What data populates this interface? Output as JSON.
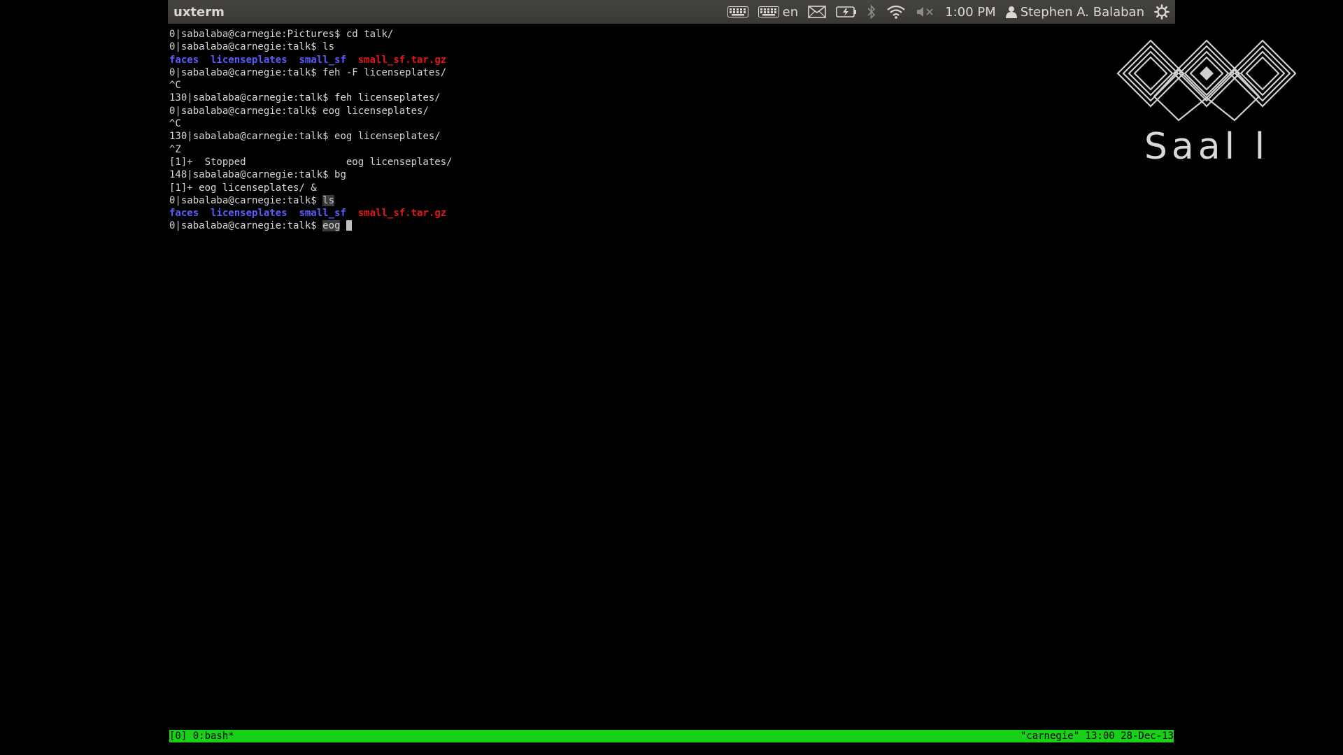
{
  "panel": {
    "window_title": "uxterm",
    "keyboard_layout": "en",
    "clock": "1:00 PM",
    "user_name": "Stephen A. Balaban",
    "icons": [
      "keyboard-icon",
      "keyboard-layout-icon",
      "mail-icon",
      "battery-icon",
      "bluetooth-icon",
      "wifi-icon",
      "volume-muted-icon",
      "user-icon",
      "gear-icon"
    ]
  },
  "terminal": {
    "lines": [
      {
        "prompt": "0|sabalaba@carnegie:Pictures$ ",
        "cmd": "cd talk/"
      },
      {
        "prompt": "0|sabalaba@carnegie:talk$ ",
        "cmd": "ls"
      },
      {
        "listing": [
          "faces",
          "licenseplates",
          "small_sf",
          "small_sf.tar.gz"
        ]
      },
      {
        "prompt": "0|sabalaba@carnegie:talk$ ",
        "cmd": "feh -F licenseplates/"
      },
      {
        "text": "^C"
      },
      {
        "prompt": "130|sabalaba@carnegie:talk$ ",
        "cmd": "feh licenseplates/"
      },
      {
        "prompt": "0|sabalaba@carnegie:talk$ ",
        "cmd": "eog licenseplates/"
      },
      {
        "text": "^C"
      },
      {
        "prompt": "130|sabalaba@carnegie:talk$ ",
        "cmd": "eog licenseplates/"
      },
      {
        "text": "^Z"
      },
      {
        "text": "[1]+  Stopped                 eog licenseplates/"
      },
      {
        "prompt": "148|sabalaba@carnegie:talk$ ",
        "cmd": "bg"
      },
      {
        "text": "[1]+ eog licenseplates/ &"
      },
      {
        "prompt": "0|sabalaba@carnegie:talk$ ",
        "cmd_selected": "ls"
      },
      {
        "listing": [
          "faces",
          "licenseplates",
          "small_sf",
          "small_sf.tar.gz"
        ]
      },
      {
        "prompt": "0|sabalaba@carnegie:talk$ ",
        "cmd_selected": "eog",
        "cursor": true
      }
    ]
  },
  "logo": {
    "text": "Saal l"
  },
  "status_bar": {
    "left": "[0] 0:bash*",
    "right": "\"carnegie\" 13:00 28-Dec-13"
  },
  "colors": {
    "panel_bg": "#3c3b37",
    "terminal_bg": "#000000",
    "directory": "#5b5bff",
    "archive": "#e01818",
    "status_bar_bg": "#17d117"
  }
}
